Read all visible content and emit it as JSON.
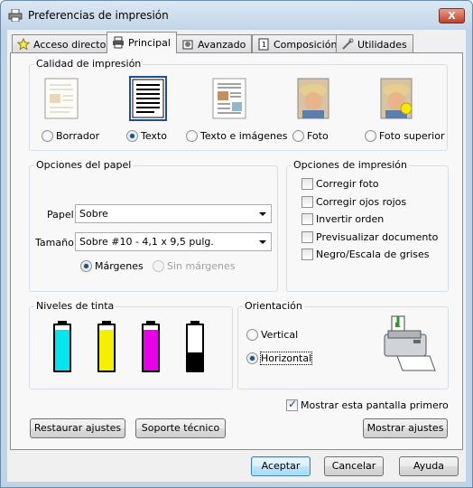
{
  "window": {
    "title": "Preferencias de impresión",
    "close_label": "X"
  },
  "tabs": [
    {
      "label": "Acceso directo",
      "icon": "star-icon"
    },
    {
      "label": "Principal",
      "icon": "printer-icon",
      "active": true
    },
    {
      "label": "Avanzado",
      "icon": "gear-icon"
    },
    {
      "label": "Composición",
      "icon": "layout-icon"
    },
    {
      "label": "Utilidades",
      "icon": "wrench-icon"
    }
  ],
  "quality": {
    "label": "Calidad de impresión",
    "options": [
      {
        "label": "Borrador",
        "selected": false
      },
      {
        "label": "Texto",
        "selected": true
      },
      {
        "label": "Texto e imágenes",
        "selected": false
      },
      {
        "label": "Foto",
        "selected": false
      },
      {
        "label": "Foto superior",
        "selected": false
      }
    ]
  },
  "paper": {
    "label": "Opciones del papel",
    "paper_label": "Papel",
    "paper_value": "Sobre",
    "size_label": "Tamaño",
    "size_value": "Sobre #10 - 4,1 x 9,5 pulg.",
    "margins_label": "Márgenes",
    "no_margins_label": "Sin márgenes"
  },
  "print_options": {
    "label": "Opciones de impresión",
    "items": [
      {
        "label": "Corregir foto",
        "checked": false
      },
      {
        "label": "Corregir ojos rojos",
        "checked": false
      },
      {
        "label": "Invertir orden",
        "checked": false
      },
      {
        "label": "Previsualizar documento",
        "checked": false
      },
      {
        "label": "Negro/Escala de grises",
        "checked": false
      }
    ]
  },
  "ink": {
    "label": "Niveles de tinta",
    "colors": [
      "#00e5ee",
      "#f5f000",
      "#e800e8",
      "#000000"
    ],
    "levels": [
      0.9,
      0.9,
      0.9,
      0.4
    ]
  },
  "orientation": {
    "label": "Orientación",
    "vertical_label": "Vertical",
    "horizontal_label": "Horizontal",
    "selected": "horizontal"
  },
  "show_screen_first": {
    "label": "Mostrar esta pantalla primero",
    "checked": true
  },
  "buttons": {
    "restore": "Restaurar ajustes",
    "support": "Soporte técnico",
    "show_settings": "Mostrar ajustes",
    "ok": "Aceptar",
    "cancel": "Cancelar",
    "help": "Ayuda"
  }
}
